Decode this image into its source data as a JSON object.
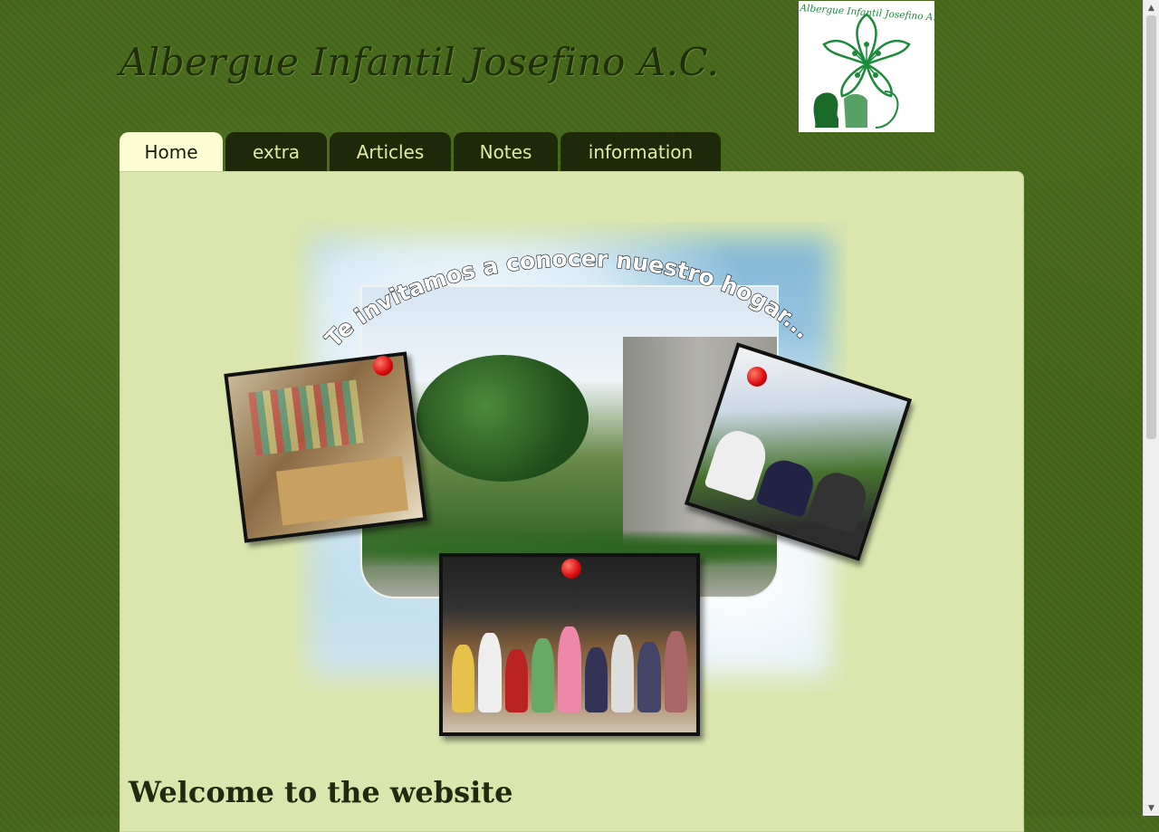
{
  "site": {
    "title": "Albergue Infantil Josefino A.C.",
    "logo_text": "Albergue Infantil Josefino A. C."
  },
  "nav": {
    "tabs": [
      {
        "label": "Home",
        "active": true
      },
      {
        "label": "extra",
        "active": false
      },
      {
        "label": "Articles",
        "active": false
      },
      {
        "label": "Notes",
        "active": false
      },
      {
        "label": "information",
        "active": false
      }
    ]
  },
  "banner": {
    "caption": "Te invitamos a conocer nuestro hogar..."
  },
  "main": {
    "heading": "Welcome to the website"
  },
  "colors": {
    "background": "#44661a",
    "content_panel": "#dae6ae",
    "tab_inactive": "#1d2908",
    "tab_active": "#fdfdd3",
    "logo_green": "#1b8a3a"
  }
}
